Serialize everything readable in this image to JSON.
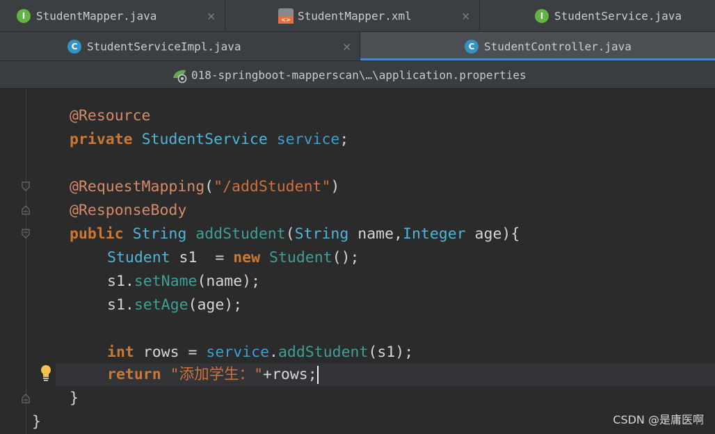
{
  "tabs_row1": [
    {
      "label": "StudentMapper.java",
      "icon": "interface-icon",
      "glyph": "I"
    },
    {
      "label": "StudentMapper.xml",
      "icon": "xml-file-icon",
      "glyph": ""
    },
    {
      "label": "StudentService.java",
      "icon": "interface-icon",
      "glyph": "I"
    }
  ],
  "tabs_row2": [
    {
      "label": "StudentServiceImpl.java",
      "icon": "class-icon",
      "glyph": "C"
    },
    {
      "label": "StudentController.java",
      "icon": "class-icon",
      "glyph": "C",
      "active": true
    }
  ],
  "close_glyph": "×",
  "path_tab": {
    "label": "018-springboot-mapperscan\\…\\application.properties",
    "icon": "spring-properties-icon"
  },
  "code": {
    "l1_annotation": "@Resource",
    "l2_kw": "private",
    "l2_type": "StudentService",
    "l2_field": "service",
    "l2_end": ";",
    "l3_annotation": "@RequestMapping",
    "l3_open": "(",
    "l3_string": "\"/addStudent\"",
    "l3_close": ")",
    "l4_annotation": "@ResponseBody",
    "l5_kw": "public",
    "l5_type": "String",
    "l5_method": "addStudent",
    "l5_open": "(",
    "l5_ptype1": "String",
    "l5_param1": " name,",
    "l5_ptype2": "Integer",
    "l5_param2": " age){",
    "l6_type": "Student",
    "l6_var": " s1  = ",
    "l6_kw": "new",
    "l6_ctor": "Student",
    "l6_end": "();",
    "l7_obj": "s1.",
    "l7_method": "setName",
    "l7_args": "(name);",
    "l8_obj": "s1.",
    "l8_method": "setAge",
    "l8_args": "(age);",
    "l9_kw": "int",
    "l9_var": " rows = ",
    "l9_field": "service",
    "l9_dot": ".",
    "l9_method": "addStudent",
    "l9_args": "(s1);",
    "l10_kw": "return",
    "l10_string": "\"添加学生：\"",
    "l10_rest": "+rows;",
    "l11_brace": "}",
    "l12_brace": "}"
  },
  "watermark": "CSDN @是庸医啊",
  "colors": {
    "keyword": "#cc7832",
    "annotation": "#d68a6a",
    "string": "#d0703e",
    "type": "#4fb6d8",
    "method": "#3e9f97",
    "active_tab_underline": "#4a88c7"
  }
}
